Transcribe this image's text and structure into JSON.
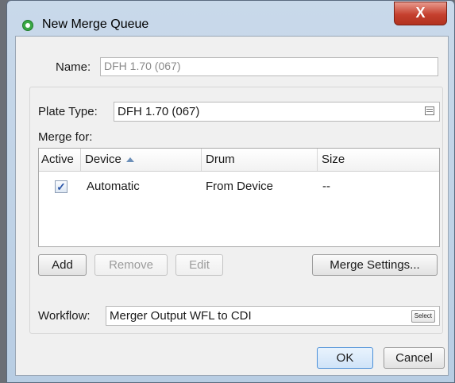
{
  "window": {
    "title": "New Merge Queue",
    "close_glyph": "X"
  },
  "name": {
    "label": "Name:",
    "value": "DFH 1.70 (067)"
  },
  "plate_type": {
    "label": "Plate Type:",
    "value": "DFH 1.70 (067)",
    "icon": "list-icon"
  },
  "merge_for": {
    "label": "Merge for:",
    "columns": [
      "Active",
      "Device",
      "Drum",
      "Size"
    ],
    "rows": [
      {
        "active": true,
        "check_glyph": "✓",
        "device": "Automatic",
        "drum": "From Device",
        "size": "--"
      }
    ]
  },
  "buttons": {
    "add": "Add",
    "remove": "Remove",
    "edit": "Edit",
    "merge_settings": "Merge Settings...",
    "ok": "OK",
    "cancel": "Cancel"
  },
  "workflow": {
    "label": "Workflow:",
    "value": "Merger Output WFL to CDI",
    "select_label": "Select"
  }
}
